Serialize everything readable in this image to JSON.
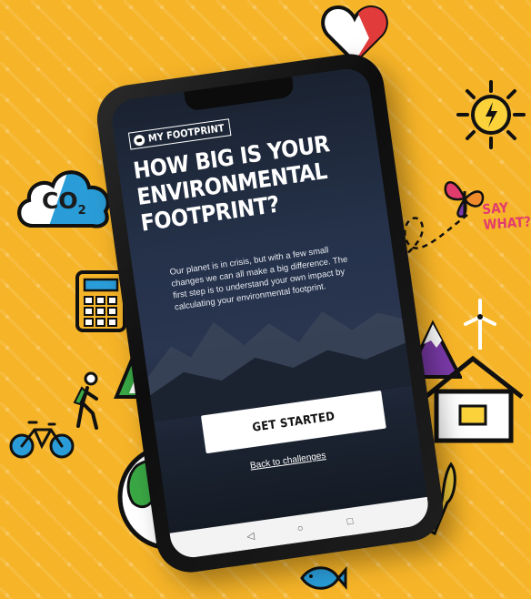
{
  "background": {
    "color": "#f6b428"
  },
  "decorations": {
    "co2_label": "CO",
    "co2_sub": "2",
    "say_what": "SAY WHAT?"
  },
  "app": {
    "brand": "MY FOOTPRINT",
    "headline": "HOW BIG IS YOUR ENVIRONMENTAL FOOTPRINT?",
    "intro": "Our planet is in crisis, but with a few small changes we can all make a big difference. The first step is to understand your own impact by calculating your environmental footprint.",
    "primary_button": "GET STARTED",
    "back_link": "Back to challenges"
  },
  "navbar": {
    "back": "◁",
    "home": "○",
    "recents": "□"
  },
  "icons": [
    "heart-icon",
    "sun-icon",
    "bee-icon",
    "butterfly-icon",
    "co2-cloud-icon",
    "calculator-icon",
    "leaf-icon",
    "tree-icon",
    "hiker-icon",
    "bicycle-icon",
    "mountains-icon",
    "wind-turbine-icon",
    "house-icon",
    "globe-icon",
    "fork-icon",
    "knife-icon",
    "fish-icon"
  ],
  "colors": {
    "accent_red": "#e23b3b",
    "accent_blue": "#2a9dd8",
    "accent_green": "#3aa845",
    "accent_purple": "#7a3aa8"
  }
}
